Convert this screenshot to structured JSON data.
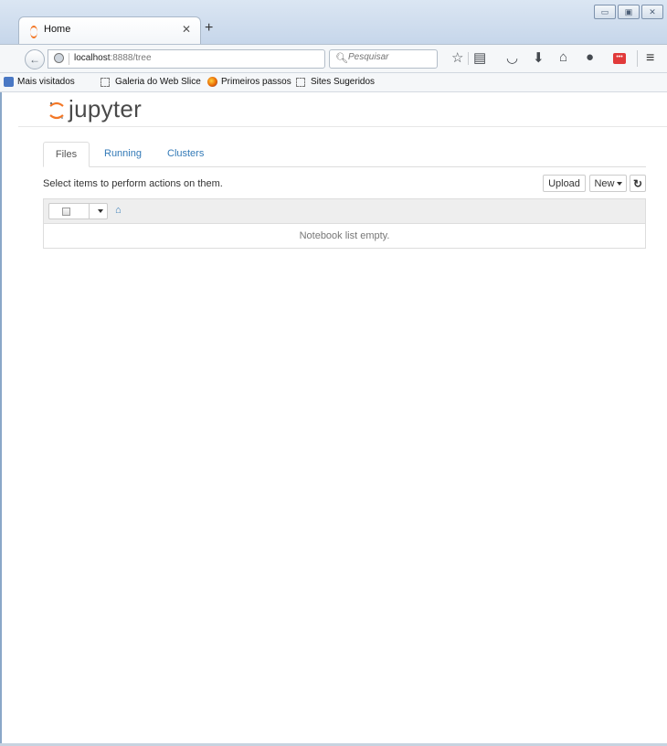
{
  "browser": {
    "tab": {
      "title": "Home"
    },
    "nav": {
      "url_host": "localhost",
      "url_rest": ":8888/tree",
      "search_placeholder": "Pesquisar"
    },
    "toolbar_icons": [
      "star-icon",
      "reading-list-icon",
      "pocket-icon",
      "download-icon",
      "home-icon",
      "chat-icon",
      "lastpass-icon",
      "menu-icon"
    ],
    "bookmarks": [
      {
        "label": "Mais visitados",
        "icon": "blue-bookmark-icon"
      },
      {
        "label": "Galeria do Web Slice",
        "icon": "dashed-icon"
      },
      {
        "label": "Primeiros passos",
        "icon": "firefox-icon"
      },
      {
        "label": "Sites Sugeridos",
        "icon": "dashed-icon"
      }
    ]
  },
  "jupyter": {
    "logo_text": "jupyter",
    "tabs": [
      "Files",
      "Running",
      "Clusters"
    ],
    "instructions": "Select items to perform actions on them.",
    "upload_label": "Upload",
    "new_label": "New",
    "empty_message": "Notebook list empty.",
    "colors": {
      "link": "#337ab7",
      "logo_orange": "#f37726"
    }
  }
}
